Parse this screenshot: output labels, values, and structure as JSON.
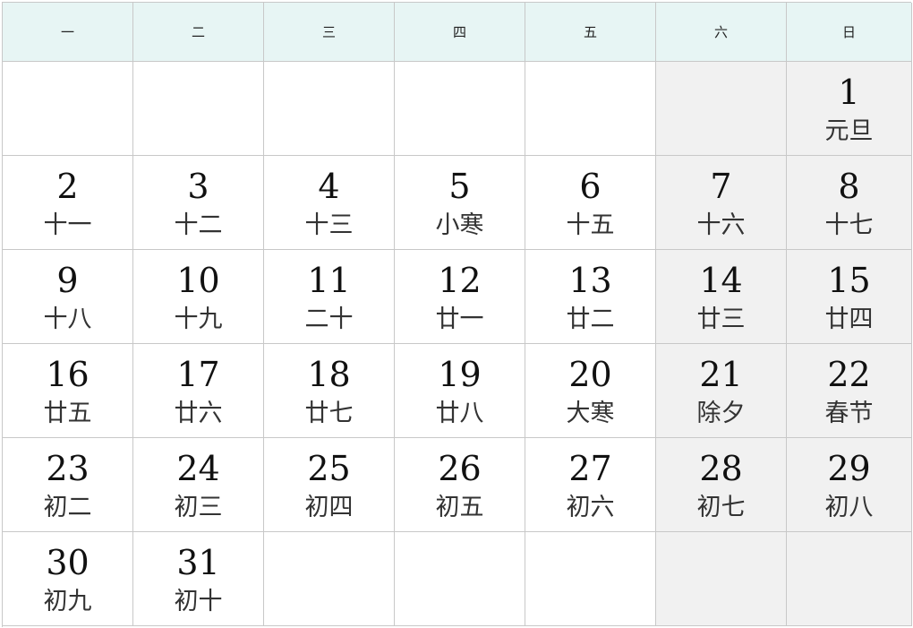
{
  "calendar": {
    "weekdays": [
      "一",
      "二",
      "三",
      "四",
      "五",
      "六",
      "日"
    ],
    "weeks": [
      [
        {
          "day": "",
          "lunar": ""
        },
        {
          "day": "",
          "lunar": ""
        },
        {
          "day": "",
          "lunar": ""
        },
        {
          "day": "",
          "lunar": ""
        },
        {
          "day": "",
          "lunar": ""
        },
        {
          "day": "",
          "lunar": ""
        },
        {
          "day": "1",
          "lunar": "元旦"
        }
      ],
      [
        {
          "day": "2",
          "lunar": "十一"
        },
        {
          "day": "3",
          "lunar": "十二"
        },
        {
          "day": "4",
          "lunar": "十三"
        },
        {
          "day": "5",
          "lunar": "小寒"
        },
        {
          "day": "6",
          "lunar": "十五"
        },
        {
          "day": "7",
          "lunar": "十六"
        },
        {
          "day": "8",
          "lunar": "十七"
        }
      ],
      [
        {
          "day": "9",
          "lunar": "十八"
        },
        {
          "day": "10",
          "lunar": "十九"
        },
        {
          "day": "11",
          "lunar": "二十"
        },
        {
          "day": "12",
          "lunar": "廿一"
        },
        {
          "day": "13",
          "lunar": "廿二"
        },
        {
          "day": "14",
          "lunar": "廿三"
        },
        {
          "day": "15",
          "lunar": "廿四"
        }
      ],
      [
        {
          "day": "16",
          "lunar": "廿五"
        },
        {
          "day": "17",
          "lunar": "廿六"
        },
        {
          "day": "18",
          "lunar": "廿七"
        },
        {
          "day": "19",
          "lunar": "廿八"
        },
        {
          "day": "20",
          "lunar": "大寒"
        },
        {
          "day": "21",
          "lunar": "除夕"
        },
        {
          "day": "22",
          "lunar": "春节"
        }
      ],
      [
        {
          "day": "23",
          "lunar": "初二"
        },
        {
          "day": "24",
          "lunar": "初三"
        },
        {
          "day": "25",
          "lunar": "初四"
        },
        {
          "day": "26",
          "lunar": "初五"
        },
        {
          "day": "27",
          "lunar": "初六"
        },
        {
          "day": "28",
          "lunar": "初七"
        },
        {
          "day": "29",
          "lunar": "初八"
        }
      ],
      [
        {
          "day": "30",
          "lunar": "初九"
        },
        {
          "day": "31",
          "lunar": "初十"
        },
        {
          "day": "",
          "lunar": ""
        },
        {
          "day": "",
          "lunar": ""
        },
        {
          "day": "",
          "lunar": ""
        },
        {
          "day": "",
          "lunar": ""
        },
        {
          "day": "",
          "lunar": ""
        }
      ]
    ]
  },
  "colors": {
    "header_bg": "#e7f5f4",
    "weekend_bg": "#f1f1f1",
    "grid_line": "#c8c8c8"
  }
}
